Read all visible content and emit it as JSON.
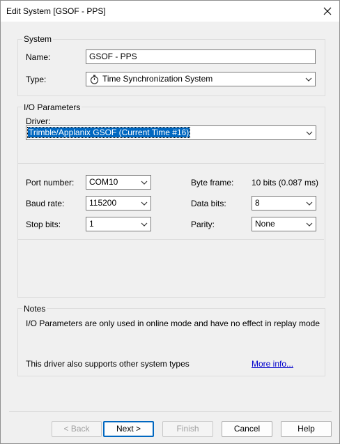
{
  "window": {
    "title": "Edit System [GSOF - PPS]",
    "close_icon": "close-icon"
  },
  "system": {
    "group_label": "System",
    "name_label": "Name:",
    "name_value": "GSOF - PPS",
    "type_label": "Type:",
    "type_value": "Time Synchronization System",
    "type_icon": "stopwatch-icon"
  },
  "io": {
    "group_label": "I/O Parameters",
    "driver_label": "Driver:",
    "driver_value": "Trimble/Applanix GSOF (Current Time #16)",
    "port_label": "Port number:",
    "port_value": "COM10",
    "baud_label": "Baud rate:",
    "baud_value": "115200",
    "stop_label": "Stop bits:",
    "stop_value": "1",
    "byteframe_label": "Byte frame:",
    "byteframe_value": "10 bits (0.087 ms)",
    "databits_label": "Data bits:",
    "databits_value": "8",
    "parity_label": "Parity:",
    "parity_value": "None"
  },
  "notes": {
    "group_label": "Notes",
    "text": "I/O Parameters are only used in online mode and have no effect in replay mode",
    "support_text": "This driver also supports other system types",
    "more_info": "More info..."
  },
  "buttons": {
    "back": "< Back",
    "next": "Next >",
    "finish": "Finish",
    "cancel": "Cancel",
    "help": "Help"
  }
}
